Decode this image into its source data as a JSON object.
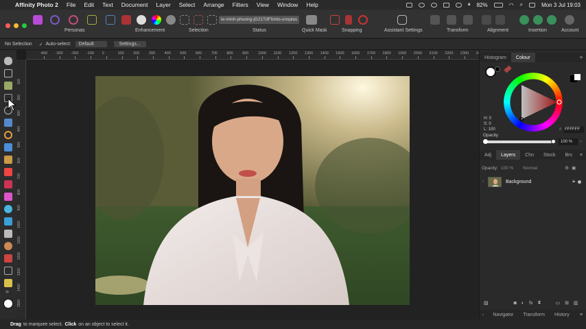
{
  "menubar": {
    "app_name": "Affinity Photo 2",
    "items": [
      "File",
      "Edit",
      "Text",
      "Document",
      "Layer",
      "Select",
      "Arrange",
      "Filters",
      "View",
      "Window",
      "Help"
    ],
    "battery": "82%",
    "clock": "Mon 3 Jul  19:03"
  },
  "toolbar": {
    "personas_label": "Personas",
    "enhancement_label": "Enhancement",
    "selection_label": "Selection",
    "status_label": "Status",
    "status_filename": "le-minh-phuong-jG21TdFhmts-unsplas",
    "quickmask_label": "Quick Mask",
    "snapping_label": "Snapping",
    "assistant_label": "Assistant Settings",
    "transform_label": "Transform",
    "alignment_label": "Alignment",
    "insertion_label": "Insertion",
    "account_label": "Account"
  },
  "context": {
    "selection_state": "No Selection",
    "autoselect_label": "Auto-select:",
    "autoselect_value": "Default",
    "settings_label": "Settings..."
  },
  "ruler": {
    "top_labels": [
      "-400",
      "-300",
      "-200",
      "-100",
      "0",
      "100",
      "200",
      "300",
      "400",
      "500",
      "600",
      "700",
      "800",
      "900",
      "1000",
      "1100",
      "1200",
      "1300",
      "1400",
      "1500",
      "1600",
      "1700",
      "1800",
      "1900",
      "2000",
      "2100",
      "2200",
      "2300",
      "2400"
    ],
    "left_labels": [
      "100",
      "200",
      "300",
      "400",
      "500",
      "600",
      "700",
      "800",
      "900",
      "1000",
      "1100",
      "1200",
      "1300",
      "1400",
      "1500"
    ]
  },
  "colour_panel": {
    "tabs": [
      "Histogram",
      "Colour"
    ],
    "active_tab": "Colour",
    "h_value": "H: 0",
    "s_value": "S: 0",
    "l_value": "L: 100",
    "hex_value": "FFFFFF",
    "opacity_label": "Opacity",
    "opacity_value": "100 %",
    "opacity_level": 1.0
  },
  "layers_panel": {
    "tabs": [
      "Adj",
      "Layers",
      "Chn",
      "Stock",
      "Brs"
    ],
    "active_tab": "Layers",
    "opacity_label": "Opacity:",
    "opacity_value": "100 %",
    "blend_mode": "Normal",
    "layers": [
      {
        "name": "Background"
      }
    ]
  },
  "bottom_tabs": [
    "Navigator",
    "Transform",
    "History"
  ],
  "statusbar": {
    "drag_word": "Drag",
    "drag_text": "to marquee select.",
    "click_word": "Click",
    "click_text": "on an object to select it."
  }
}
